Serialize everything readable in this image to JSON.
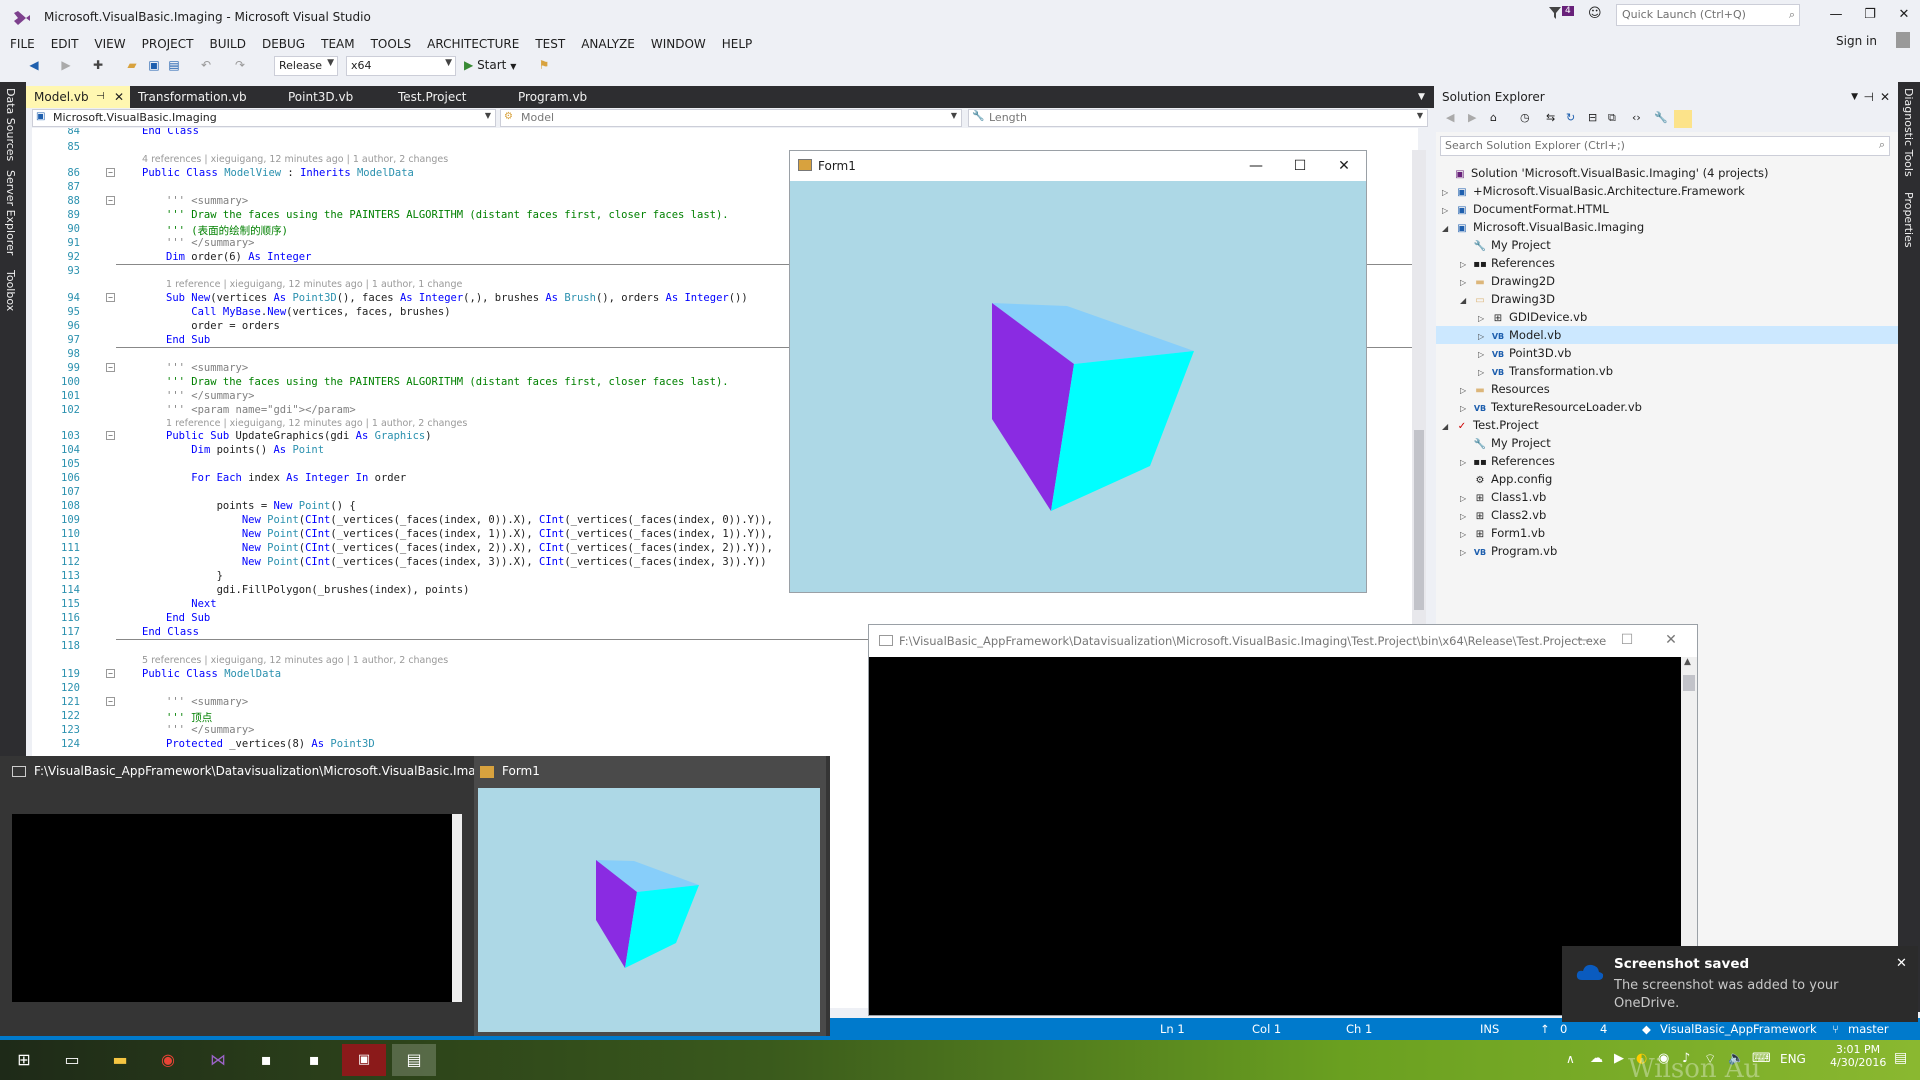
{
  "window": {
    "title": "Microsoft.VisualBasic.Imaging - Microsoft Visual Studio"
  },
  "quick_launch": {
    "placeholder": "Quick Launch (Ctrl+Q)"
  },
  "notification_count": "4",
  "sign_in": "Sign in",
  "menu": [
    "FILE",
    "EDIT",
    "VIEW",
    "PROJECT",
    "BUILD",
    "DEBUG",
    "TEAM",
    "TOOLS",
    "ARCHITECTURE",
    "TEST",
    "ANALYZE",
    "WINDOW",
    "HELP"
  ],
  "toolbar": {
    "config": "Release",
    "platform": "x64",
    "start": "Start"
  },
  "left_tabs": [
    "Data Sources",
    "Server Explorer",
    "Toolbox"
  ],
  "right_tabs": [
    "Diagnostic Tools",
    "Properties"
  ],
  "doc_tabs": [
    "Model.vb",
    "Transformation.vb",
    "Point3D.vb",
    "Test.Project",
    "Program.vb"
  ],
  "nav": {
    "project": "Microsoft.VisualBasic.Imaging",
    "type": "Model",
    "member": "Length"
  },
  "code": {
    "lines": [
      {
        "n": "84",
        "t": "End Class"
      },
      {
        "n": "85",
        "t": ""
      },
      {
        "n": "86",
        "t": "Public Class ModelView : Inherits ModelData"
      },
      {
        "n": "87",
        "t": ""
      },
      {
        "n": "88",
        "t": "''' <summary>"
      },
      {
        "n": "89",
        "t": "''' Draw the faces using the PAINTERS ALGORITHM (distant faces first, closer faces last)."
      },
      {
        "n": "90",
        "t": "''' (表面的绘制的顺序)"
      },
      {
        "n": "91",
        "t": "''' </summary>"
      },
      {
        "n": "92",
        "t": "Dim order(6) As Integer"
      },
      {
        "n": "93",
        "t": ""
      },
      {
        "n": "94",
        "t": "Sub New(vertices As Point3D(), faces As Integer(,), brushes As Brush(), orders As Integer())"
      },
      {
        "n": "95",
        "t": "    Call MyBase.New(vertices, faces, brushes)"
      },
      {
        "n": "96",
        "t": "    order = orders"
      },
      {
        "n": "97",
        "t": "End Sub"
      },
      {
        "n": "98",
        "t": ""
      },
      {
        "n": "99",
        "t": "''' <summary>"
      },
      {
        "n": "100",
        "t": "''' Draw the faces using the PAINTERS ALGORITHM (distant faces first, closer faces last)."
      },
      {
        "n": "101",
        "t": "''' </summary>"
      },
      {
        "n": "102",
        "t": "''' <param name=\"gdi\"></param>"
      },
      {
        "n": "103",
        "t": "Public Sub UpdateGraphics(gdi As Graphics)"
      },
      {
        "n": "104",
        "t": "    Dim points() As Point"
      },
      {
        "n": "105",
        "t": ""
      },
      {
        "n": "106",
        "t": "    For Each index As Integer In order"
      },
      {
        "n": "107",
        "t": ""
      },
      {
        "n": "108",
        "t": "        points = New Point() {"
      },
      {
        "n": "109",
        "t": "            New Point(CInt(_vertices(_faces(index, 0)).X), CInt(_vertices(_faces(index, 0)).Y)),"
      },
      {
        "n": "110",
        "t": "            New Point(CInt(_vertices(_faces(index, 1)).X), CInt(_vertices(_faces(index, 1)).Y)),"
      },
      {
        "n": "111",
        "t": "            New Point(CInt(_vertices(_faces(index, 2)).X), CInt(_vertices(_faces(index, 2)).Y)),"
      },
      {
        "n": "112",
        "t": "            New Point(CInt(_vertices(_faces(index, 3)).X), CInt(_vertices(_faces(index, 3)).Y))"
      },
      {
        "n": "113",
        "t": "        }"
      },
      {
        "n": "114",
        "t": "        gdi.FillPolygon(_brushes(index), points)"
      },
      {
        "n": "115",
        "t": "    Next"
      },
      {
        "n": "116",
        "t": "End Sub"
      },
      {
        "n": "117",
        "t": "End Class"
      },
      {
        "n": "118",
        "t": ""
      },
      {
        "n": "119",
        "t": "Public Class ModelData"
      },
      {
        "n": "120",
        "t": ""
      },
      {
        "n": "121",
        "t": "''' <summary>"
      },
      {
        "n": "122",
        "t": "''' 顶点"
      },
      {
        "n": "123",
        "t": "''' </summary>"
      },
      {
        "n": "124",
        "t": "Protected _vertices(8) As Point3D"
      }
    ],
    "lens": [
      "4 references | xieguigang, 12 minutes ago | 1 author, 2 changes",
      "1 reference | xieguigang, 12 minutes ago | 1 author, 1 change",
      "1 reference | xieguigang, 12 minutes ago | 1 author, 2 changes",
      "5 references | xieguigang, 12 minutes ago | 1 author, 2 changes"
    ]
  },
  "solution_explorer": {
    "title": "Solution Explorer",
    "search_placeholder": "Search Solution Explorer (Ctrl+;)",
    "nodes": [
      {
        "label": "Solution 'Microsoft.VisualBasic.Imaging' (4 projects)",
        "icon": "solution-icon"
      },
      {
        "label": "+Microsoft.VisualBasic.Architecture.Framework",
        "icon": "vb-project-icon"
      },
      {
        "label": "DocumentFormat.HTML",
        "icon": "vb-project-icon"
      },
      {
        "label": "Microsoft.VisualBasic.Imaging",
        "icon": "vb-project-icon"
      },
      {
        "label": "My Project",
        "icon": "wrench-icon"
      },
      {
        "label": "References",
        "icon": "references-icon"
      },
      {
        "label": "Drawing2D",
        "icon": "folder-icon"
      },
      {
        "label": "Drawing3D",
        "icon": "folder-open-icon"
      },
      {
        "label": "GDIDevice.vb",
        "icon": "form-icon"
      },
      {
        "label": "Model.vb",
        "icon": "vb-file-icon"
      },
      {
        "label": "Point3D.vb",
        "icon": "vb-file-icon"
      },
      {
        "label": "Transformation.vb",
        "icon": "vb-file-icon"
      },
      {
        "label": "Resources",
        "icon": "folder-icon"
      },
      {
        "label": "TextureResourceLoader.vb",
        "icon": "vb-file-icon"
      },
      {
        "label": "Test.Project",
        "icon": "vb-project-icon"
      },
      {
        "label": "My Project",
        "icon": "wrench-icon"
      },
      {
        "label": "References",
        "icon": "references-icon"
      },
      {
        "label": "App.config",
        "icon": "config-icon"
      },
      {
        "label": "Class1.vb",
        "icon": "form-icon"
      },
      {
        "label": "Class2.vb",
        "icon": "form-icon"
      },
      {
        "label": "Form1.vb",
        "icon": "form-icon"
      },
      {
        "label": "Program.vb",
        "icon": "vb-file-icon"
      }
    ]
  },
  "form1": {
    "title": "Form1",
    "colors": {
      "background": "#add8e6",
      "top_face": "#87cefa",
      "left_face": "#8a2be2",
      "right_face": "#00ffff"
    }
  },
  "console": {
    "title": "F:\\VisualBasic_AppFramework\\Datavisualization\\Microsoft.VisualBasic.Imaging\\Test.Project\\bin\\x64\\Release\\Test.Project.exe"
  },
  "thumbs": {
    "console_title": "F:\\VisualBasic_AppFramework\\Datavisualization\\Microsoft.VisualBasic.Imaging...",
    "form_title": "Form1"
  },
  "status": {
    "ln": "Ln 1",
    "col": "Col 1",
    "ch": "Ch 1",
    "ins": "INS",
    "push": "0",
    "changes": "4",
    "repo": "VisualBasic_AppFramework",
    "branch": "master"
  },
  "toast": {
    "title": "Screenshot saved",
    "body": "The screenshot was added to your OneDrive."
  },
  "tray": {
    "lang": "ENG",
    "time": "3:01 PM",
    "date": "4/30/2016"
  },
  "watermark": "Wilson Au"
}
